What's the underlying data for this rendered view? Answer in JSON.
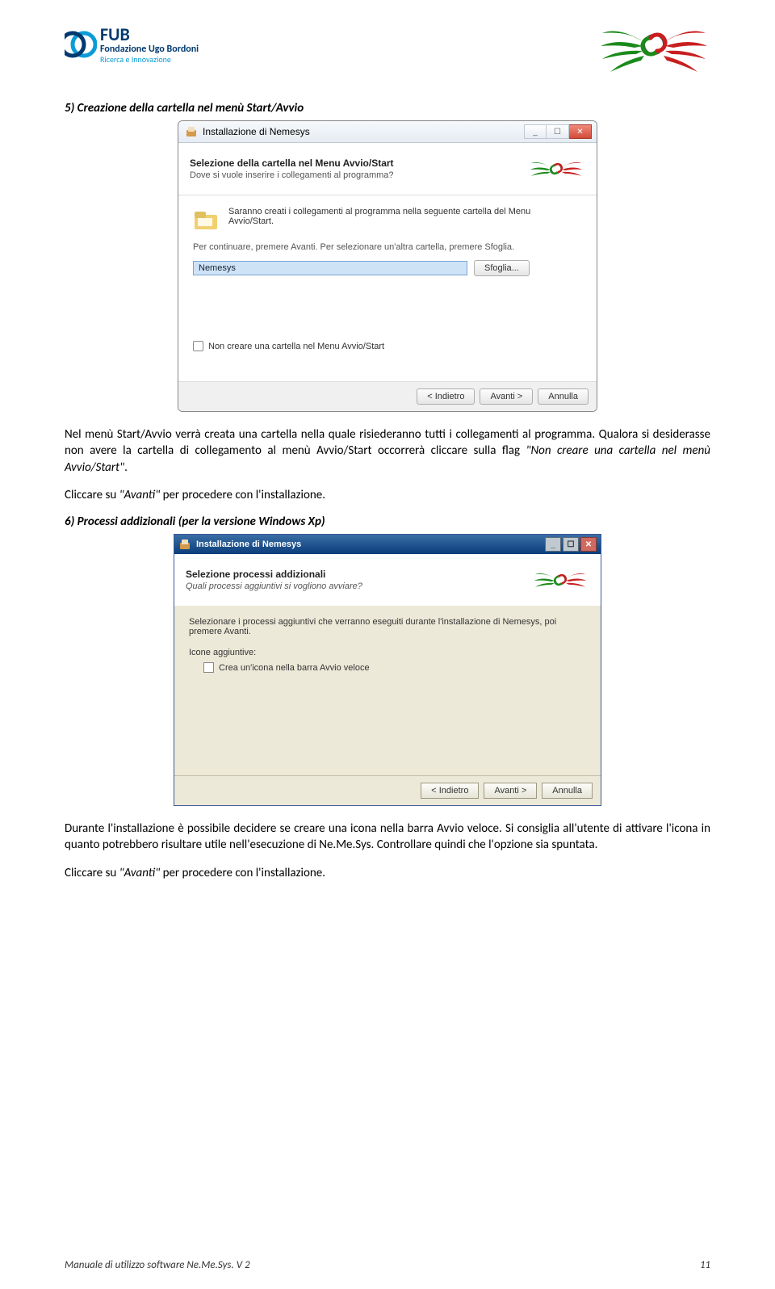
{
  "header": {
    "fub_title": "FUB",
    "fub_line1": "Fondazione Ugo Bordoni",
    "fub_line2": "Ricerca e Innovazione"
  },
  "section5": {
    "heading": "5) Creazione della cartella nel menù Start/Avvio",
    "para1a": "Nel menù Start/Avvio verrà creata una cartella nella quale risiederanno tutti i collegamenti al programma. Qualora si desiderasse non avere la cartella di collegamento al menù Avvio/Start occorrerà cliccare sulla flag ",
    "para1_flag": "\"Non creare una cartella nel menù Avvio/Start\"",
    "para1b": ".",
    "click_next": "Cliccare su ",
    "avanti_q": "\"Avanti\"",
    "click_rest": " per procedere con l'installazione."
  },
  "dialog7": {
    "title": "Installazione di Nemesys",
    "hdr_title": "Selezione della cartella nel Menu Avvio/Start",
    "hdr_sub": "Dove si vuole inserire i collegamenti al programma?",
    "body_text1": "Saranno creati i collegamenti al programma nella seguente cartella del Menu Avvio/Start.",
    "body_text2": "Per continuare, premere Avanti. Per selezionare un'altra cartella, premere Sfoglia.",
    "input_value": "Nemesys",
    "browse_btn": "Sfoglia...",
    "checkbox_label": "Non creare una cartella nel Menu Avvio/Start",
    "back_btn": "< Indietro",
    "next_btn": "Avanti >",
    "cancel_btn": "Annulla"
  },
  "section6": {
    "heading": "6) Processi addizionali (per la versione Windows Xp)",
    "para1": "Durante l'installazione è possibile decidere se creare una icona nella barra Avvio veloce. Si consiglia all'utente di attivare l'icona in quanto potrebbero risultare utile nell'esecuzione di Ne.Me.Sys. Controllare quindi che l'opzione sia spuntata.",
    "click_next": "Cliccare su ",
    "avanti_q": "\"Avanti\"",
    "click_rest": " per procedere con l'installazione."
  },
  "dialogxp": {
    "title": "Installazione di Nemesys",
    "hdr_title": "Selezione processi addizionali",
    "hdr_sub": "Quali processi aggiuntivi si vogliono avviare?",
    "body_text1": "Selezionare i processi aggiuntivi che verranno eseguiti durante l'installazione di Nemesys, poi premere Avanti.",
    "icons_label": "Icone aggiuntive:",
    "checkbox_label": "Crea un'icona nella barra Avvio veloce",
    "back_btn": "< Indietro",
    "next_btn": "Avanti >",
    "cancel_btn": "Annulla"
  },
  "footer": {
    "left": "Manuale di utilizzo software Ne.Me.Sys. V 2",
    "right": "11"
  },
  "icons": {
    "minimize": "_",
    "maximize": "☐",
    "close": "✕",
    "underscore": "_"
  }
}
